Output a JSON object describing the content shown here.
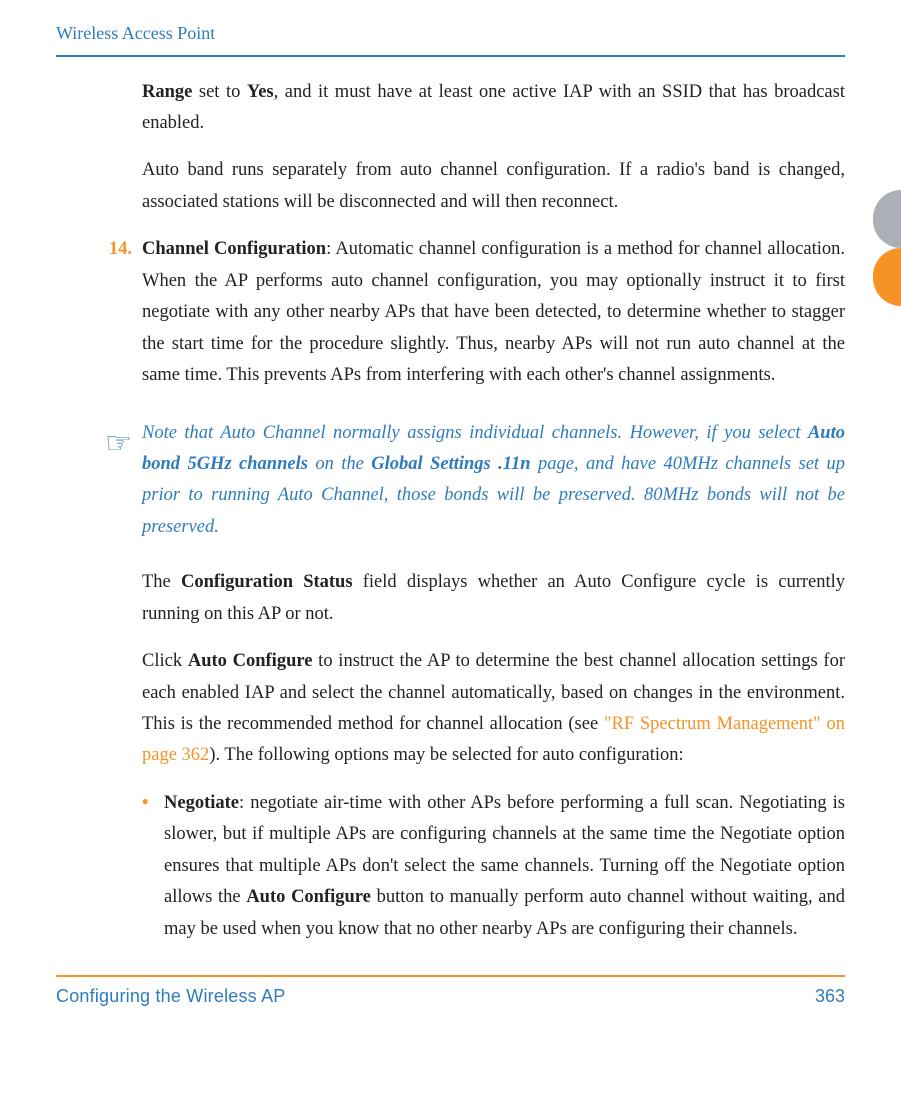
{
  "header": {
    "title": "Wireless Access Point"
  },
  "p1": {
    "pre": "Range",
    "mid": " set to ",
    "yes": "Yes",
    "post": ", and it must have at least one active IAP with an SSID that has broadcast enabled."
  },
  "p2": "Auto band runs separately from auto channel configuration. If a radio's band is changed, associated stations will be disconnected and will then reconnect.",
  "item14": {
    "num": "14.",
    "lead": "Channel Configuration",
    "body": ": Automatic channel configuration is a method for channel allocation. When the AP performs auto channel configuration, you may optionally instruct it to first negotiate with any other nearby APs that have been detected, to determine whether to stagger the start time for the procedure slightly. Thus, nearby APs will not run auto channel at the same time. This prevents APs from interfering with each other's channel assignments."
  },
  "note": {
    "pre": "Note that Auto Channel normally assigns individual channels. However, if you select ",
    "b1": "Auto bond 5GHz channels",
    "mid1": " on the ",
    "b2": "Global Settings .11n",
    "mid2": " page, and have 40MHz channels set up prior to running Auto Channel, those bonds will be preserved. 80MHz bonds will not be preserved."
  },
  "p3": {
    "pre": "The ",
    "b": "Configuration Status",
    "post": " field displays whether an Auto Configure cycle is currently running on this AP or not."
  },
  "p4": {
    "pre": "Click ",
    "b": "Auto Configure",
    "mid": " to instruct the AP to determine the best channel allocation settings for each enabled IAP and select the channel automatically, based on changes in the environment. This is the recommended method for channel allocation (see ",
    "link": "\"RF Spectrum Management\" on page 362",
    "post": "). The following options may be selected for auto configuration:"
  },
  "bullet": {
    "lead": "Negotiate",
    "t1": ": negotiate air-time with other APs before performing a full scan. Negotiating is slower, but if multiple APs are configuring channels at the same time the Negotiate option ensures that multiple APs don't select the same channels. Turning off the Negotiate option allows the ",
    "b": "Auto Configure",
    "t2": " button to manually perform auto channel without waiting, and may be used when you know that no other nearby APs are configuring their channels."
  },
  "footer": {
    "title": "Configuring the Wireless AP",
    "page": "363"
  }
}
